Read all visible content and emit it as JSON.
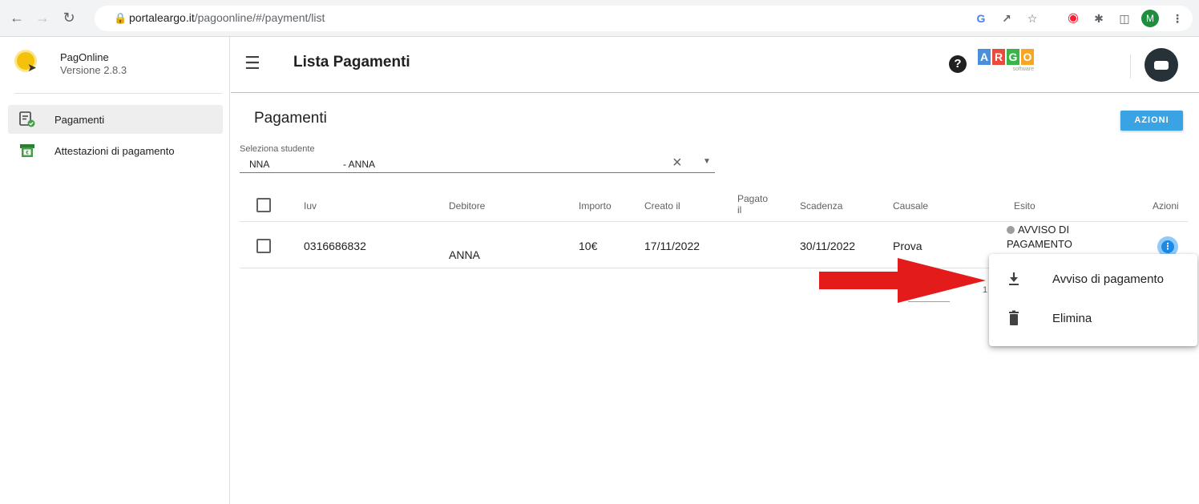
{
  "browser": {
    "url_host": "portaleargo.it",
    "url_path": "/pagoonline/#/payment/list",
    "profile_initial": "M"
  },
  "app": {
    "name": "PagOnline",
    "version": "Versione 2.8.3"
  },
  "sidebar": {
    "items": [
      {
        "label": "Pagamenti",
        "icon": "payments-list-icon",
        "active": true
      },
      {
        "label": "Attestazioni di pagamento",
        "icon": "receipt-icon",
        "active": false
      }
    ]
  },
  "header": {
    "title": "Lista Pagamenti",
    "brand_letters": [
      "A",
      "R",
      "G",
      "O"
    ],
    "brand_colors": [
      "#4a8fd8",
      "#e94b3c",
      "#3bb54a",
      "#f5a623"
    ],
    "brand_sub": "software"
  },
  "content": {
    "section_title": "Pagamenti",
    "actions_button": "AZIONI",
    "student_select": {
      "label": "Seleziona studente",
      "value_part1": "NNA",
      "value_part2": "- ANNA"
    },
    "table": {
      "headers": {
        "iuv": "Iuv",
        "debitore": "Debitore",
        "importo": "Importo",
        "creato": "Creato il",
        "pagato_line1": "Pagato",
        "pagato_line2": "il",
        "scadenza": "Scadenza",
        "causale": "Causale",
        "esito": "Esito",
        "azioni": "Azioni"
      },
      "rows": [
        {
          "iuv": "0316686832",
          "debitore": "ANNA",
          "importo": "10€",
          "creato": "17/11/2022",
          "pagato": "",
          "scadenza": "30/11/2022",
          "causale": "Prova",
          "esito_line1": "AVVISO DI",
          "esito_line2": "PAGAMENTO"
        }
      ]
    },
    "pager_fragment": "1"
  },
  "menu": {
    "items": [
      {
        "label": "Avviso di pagamento",
        "icon": "download-icon"
      },
      {
        "label": "Elimina",
        "icon": "trash-icon"
      }
    ]
  },
  "colors": {
    "accent": "#3aa3e3",
    "annotation_arrow": "#e31b1b"
  }
}
